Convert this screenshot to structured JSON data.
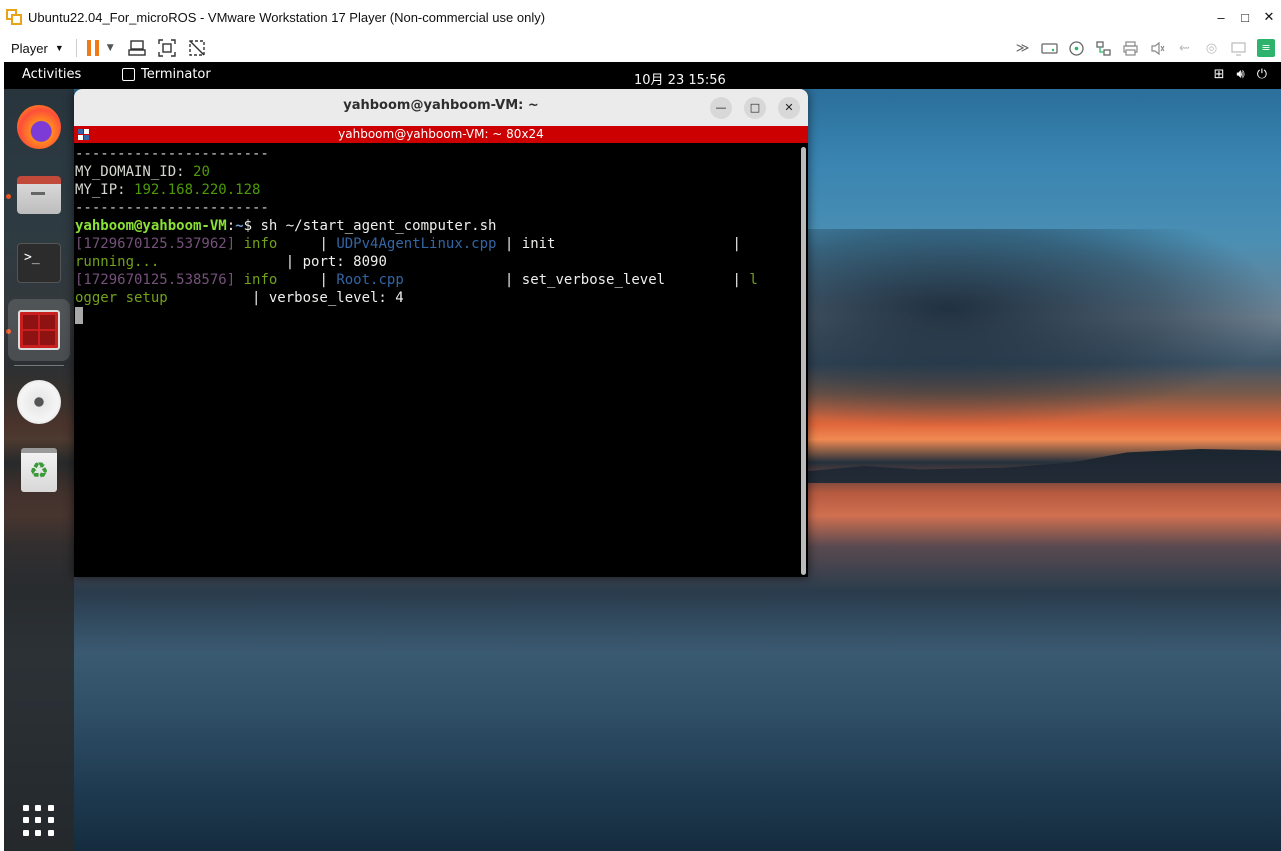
{
  "host": {
    "title": "Ubuntu22.04_For_microROS - VMware Workstation 17 Player (Non-commercial use only)",
    "controls": {
      "minimize": "–",
      "maximize": "□",
      "close": "✕"
    },
    "toolbar": {
      "player_label": "Player"
    }
  },
  "topbar": {
    "activities": "Activities",
    "app_name": "Terminator",
    "clock": "10月 23  15:56"
  },
  "dock": {
    "items": [
      "firefox-icon",
      "files-icon",
      "terminal-icon",
      "terminator-icon",
      "cd-icon",
      "trash-icon",
      "apps-grid-icon"
    ]
  },
  "terminal": {
    "window_title": "yahboom@yahboom-VM: ~",
    "pane_title": "yahboom@yahboom-VM: ~ 80x24",
    "lines": {
      "sep1": "-----------------------",
      "domain_key": "MY_DOMAIN_ID: ",
      "domain_val": "20",
      "ip_key": "MY_IP: ",
      "ip_val": "192.168.220.128",
      "sep2": "-----------------------",
      "prompt_user": "yahboom@yahboom-VM",
      "prompt_colon": ":",
      "prompt_path": "~",
      "prompt_sym": "$ ",
      "command": "sh ~/start_agent_computer.sh",
      "l1_ts": "[1729670125.537962]",
      "l1_level": " info     ",
      "l1_sep1": "| ",
      "l1_file": "UDPv4AgentLinux.cpp",
      "l1_sep2": " | ",
      "l1_func": "init                     ",
      "l1_sep3": "|",
      "l2_msg": "running...",
      "l2_rest": "               | port: 8090",
      "l3_ts": "[1729670125.538576]",
      "l3_level": " info     ",
      "l3_sep1": "| ",
      "l3_file": "Root.cpp",
      "l3_sep2": "            | ",
      "l3_func": "set_verbose_level        ",
      "l3_sep3": "| ",
      "l3_msgstart": "l",
      "l4_msg": "ogger setup",
      "l4_rest": "          | verbose_level: 4"
    }
  }
}
